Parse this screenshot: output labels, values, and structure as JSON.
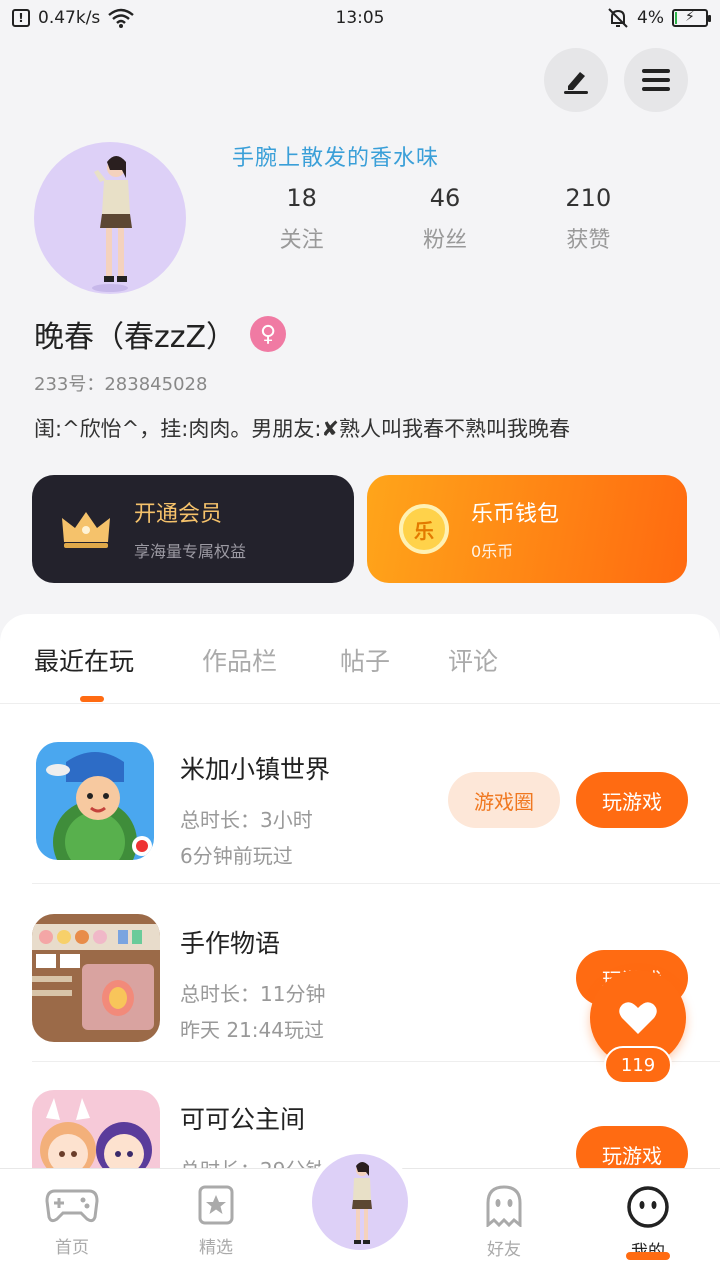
{
  "status_bar": {
    "net_speed": "0.47k/s",
    "time": "13:05",
    "battery_percent": "4%",
    "battery_level": 0.04
  },
  "profile": {
    "marquee_text": "手腕上散发的香水味",
    "stats": [
      {
        "num": "18",
        "label": "关注"
      },
      {
        "num": "46",
        "label": "粉丝"
      },
      {
        "num": "210",
        "label": "获赞"
      }
    ],
    "nickname": "晚春（春zzZ）",
    "gender_symbol": "♀",
    "uid": "233号：283845028",
    "bio": "闺:^欣怡^，挂:肉肉。男朋友:✘熟人叫我春不熟叫我晚春"
  },
  "cards": {
    "vip_title": "开通会员",
    "vip_sub": "享海量专属权益",
    "wallet_title": "乐币钱包",
    "wallet_sub": "0乐币",
    "wallet_coin_char": "乐"
  },
  "tabs": [
    "最近在玩",
    "作品栏",
    "帖子",
    "评论"
  ],
  "games": [
    {
      "name": "米加小镇世界",
      "duration": "总时长：3小时",
      "last_played": "6分钟前玩过",
      "circle_label": "游戏圈",
      "play_label": "玩游戏"
    },
    {
      "name": "手作物语",
      "duration": "总时长：11分钟",
      "last_played": "昨天 21:44玩过",
      "play_label": "玩游戏"
    },
    {
      "name": "可可公主间",
      "duration": "总时长：29分钟",
      "play_label": "玩游戏"
    }
  ],
  "like": {
    "count": "119"
  },
  "bottom_nav": [
    {
      "label": "首页",
      "icon": "gamepad-icon"
    },
    {
      "label": "精选",
      "icon": "star-icon"
    },
    {
      "label": "",
      "icon": "avatar-icon"
    },
    {
      "label": "好友",
      "icon": "ghost-icon"
    },
    {
      "label": "我的",
      "icon": "face-icon"
    }
  ],
  "colors": {
    "accent": "#ff6b12",
    "vip_bg": "#23222c",
    "gold": "#f5c26b",
    "avatar_bg": "#ddd0f7"
  }
}
